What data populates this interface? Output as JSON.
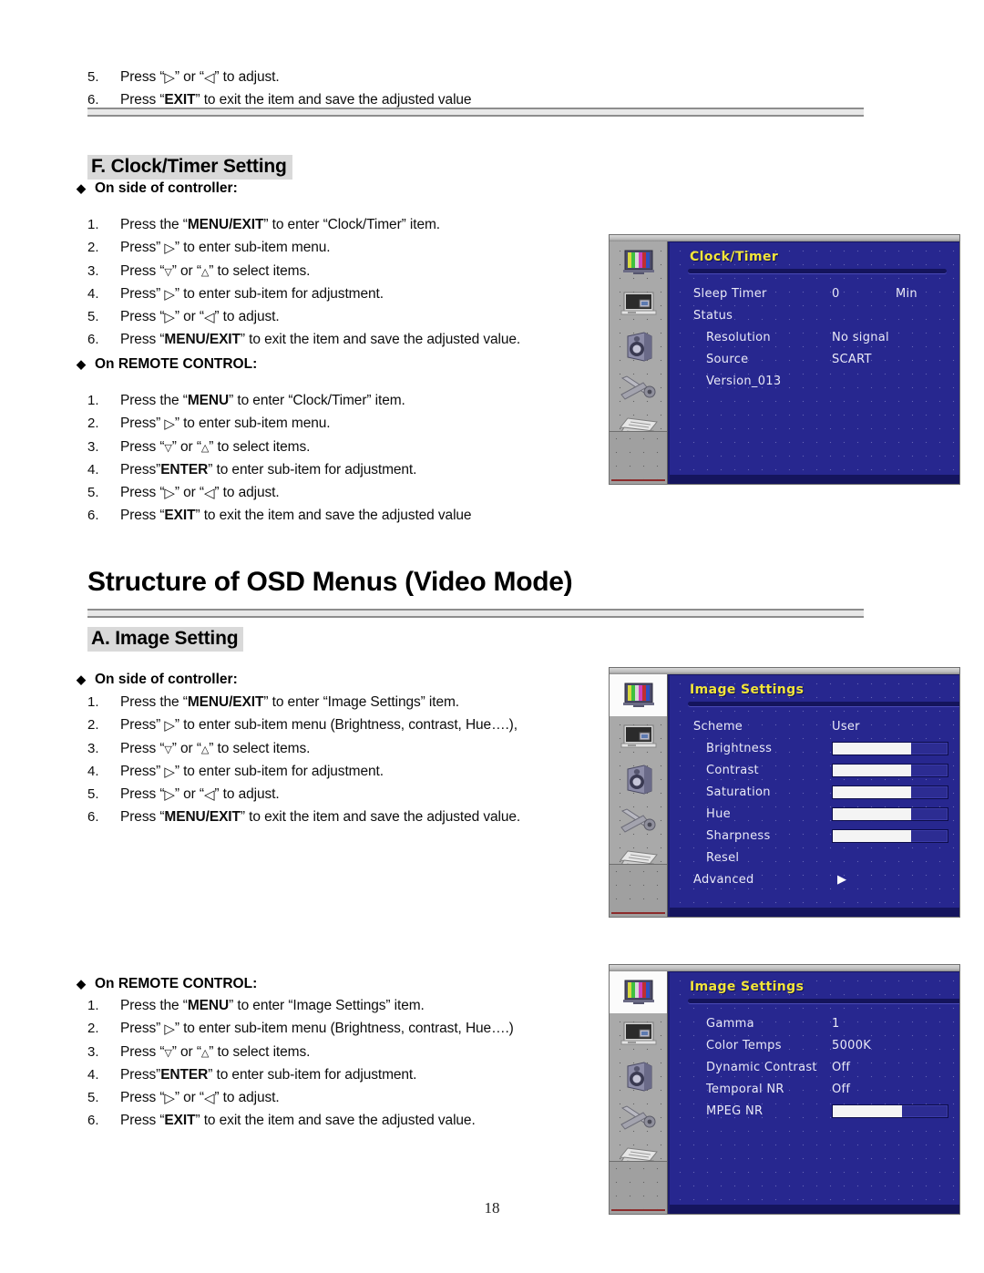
{
  "page": {
    "number": "18"
  },
  "top_steps": [
    {
      "num": "5.",
      "pre": "Press “",
      "sym": "▷",
      "mid": "” or “",
      "sym2": "◁",
      "post": "” to adjust."
    },
    {
      "num": "6.",
      "pre": "Press “",
      "bold": "EXIT",
      "post": "” to exit the item and save the adjusted value"
    }
  ],
  "clock_section": {
    "heading": "F. Clock/Timer Setting",
    "controller_label": "On side of controller:",
    "controller_steps": [
      {
        "num": "1.",
        "pre": "Press the “",
        "bold": "MENU/EXIT",
        "post": "” to enter “Clock/Timer” item."
      },
      {
        "num": "2.",
        "pre": "Press” ",
        "sym": "▷",
        "post": "” to enter sub-item menu."
      },
      {
        "num": "3.",
        "pre": "Press “",
        "symsm": "▽",
        "mid": "” or “",
        "symsm2": "△",
        "post": "” to select items."
      },
      {
        "num": "4.",
        "pre": "Press” ",
        "sym": "▷",
        "post": "” to enter sub-item for adjustment."
      },
      {
        "num": "5.",
        "pre": "Press “",
        "sym": "▷",
        "mid": "” or “",
        "sym2": "◁",
        "post": "” to adjust."
      },
      {
        "num": "6.",
        "pre": "Press “",
        "bold": "MENU/EXIT",
        "post": "” to exit the item and save the adjusted value."
      }
    ],
    "remote_label": "On REMOTE CONTROL:",
    "remote_steps": [
      {
        "num": "1.",
        "pre": "Press the “",
        "bold": "MENU",
        "post": "” to enter “Clock/Timer” item."
      },
      {
        "num": "2.",
        "pre": "Press” ",
        "sym": "▷",
        "post": "” to enter sub-item menu."
      },
      {
        "num": "3.",
        "pre": "Press “",
        "symsm": "▽",
        "mid": "” or “",
        "symsm2": "△",
        "post": "” to select items."
      },
      {
        "num": "4.",
        "pre": "Press”",
        "bold": "ENTER",
        "post": "” to enter sub-item for adjustment."
      },
      {
        "num": "5.",
        "pre": "Press “",
        "sym": "▷",
        "mid": "” or “",
        "sym2": "◁",
        "post": "” to adjust."
      },
      {
        "num": "6.",
        "pre": "Press “",
        "bold": "EXIT",
        "post": "” to exit the item and save the adjusted value"
      }
    ]
  },
  "structure_title": "Structure of OSD Menus (Video Mode)",
  "image_section": {
    "heading": "A. Image Setting",
    "controller_label": "On side of controller:",
    "controller_steps": [
      {
        "num": "1.",
        "pre": "Press the “",
        "bold": "MENU/EXIT",
        "post": "” to enter “Image Settings” item."
      },
      {
        "num": "2.",
        "pre": "Press” ",
        "sym": "▷",
        "post": "” to enter sub-item menu (Brightness, contrast, Hue….),"
      },
      {
        "num": "3.",
        "pre": "Press “",
        "symsm": "▽",
        "mid": "” or “",
        "symsm2": "△",
        "post": "” to select items."
      },
      {
        "num": "4.",
        "pre": "Press” ",
        "sym": "▷",
        "post": "” to enter sub-item for adjustment."
      },
      {
        "num": "5.",
        "pre": "Press “",
        "sym": "▷",
        "mid": "” or “",
        "sym2": "◁",
        "post": "” to adjust."
      },
      {
        "num": "6.",
        "pre": "Press “",
        "bold": "MENU/EXIT",
        "post": "” to exit the item and save the adjusted value."
      }
    ],
    "remote_label": "On REMOTE CONTROL:",
    "remote_steps": [
      {
        "num": "1.",
        "pre": "Press the “",
        "bold": "MENU",
        "post": "” to enter “Image Settings” item."
      },
      {
        "num": "2.",
        "pre": "Press” ",
        "sym": "▷",
        "post": "” to enter sub-item menu (Brightness, contrast, Hue….)"
      },
      {
        "num": "3.",
        "pre": "Press “",
        "symsm": "▽",
        "mid": "” or “",
        "symsm2": "△",
        "post": "” to select items."
      },
      {
        "num": "4.",
        "pre": "Press”",
        "bold": "ENTER",
        "post": "” to enter sub-item for adjustment."
      },
      {
        "num": "5.",
        "pre": "Press “",
        "sym": "▷",
        "mid": "” or “",
        "sym2": "◁",
        "post": "” to adjust."
      },
      {
        "num": "6.",
        "pre": "Press “",
        "bold": "EXIT",
        "post": "” to exit the item and save the adjusted value."
      }
    ]
  },
  "osd_colors": {
    "background": "#27278f",
    "title_text": "#f2e53a",
    "row_text": "#e9e9f6",
    "sidebar": "#a9a9a9",
    "header_bar": "#15155e"
  },
  "osd_sidebar_icons": [
    "picture-tv-icon",
    "pc-monitor-icon",
    "speaker-icon",
    "wrench-tool-icon",
    "documents-icon",
    "clock-icon"
  ],
  "osd_clock_timer": {
    "title": "Clock/Timer",
    "selected_icon_index": 5,
    "rows": [
      {
        "label": "Sleep Timer",
        "value": "0",
        "unit": "Min",
        "indent": 0
      },
      {
        "label": "Status",
        "value": "",
        "unit": "",
        "indent": 0
      },
      {
        "label": "Resolution",
        "value": "No signal",
        "unit": "",
        "indent": 1
      },
      {
        "label": "Source",
        "value": "SCART",
        "unit": "",
        "indent": 1
      },
      {
        "label": "Version_013",
        "value": "",
        "unit": "",
        "indent": 1
      }
    ]
  },
  "osd_image_settings": {
    "title": "Image Settings",
    "selected_icon_index": 0,
    "rows": [
      {
        "label": "Scheme",
        "value": "User",
        "type": "text",
        "indent": 0
      },
      {
        "label": "Brightness",
        "type": "slider",
        "fill": 68,
        "value": "0",
        "indent": 1
      },
      {
        "label": "Contrast",
        "type": "slider",
        "fill": 68,
        "value": "0",
        "indent": 1
      },
      {
        "label": "Saturation",
        "type": "slider",
        "fill": 68,
        "value": "0",
        "indent": 1
      },
      {
        "label": "Hue",
        "type": "slider",
        "fill": 68,
        "value": "0",
        "indent": 1
      },
      {
        "label": "Sharpness",
        "type": "slider",
        "fill": 68,
        "value": "0",
        "indent": 1
      },
      {
        "label": "Resel",
        "type": "text",
        "value": "",
        "indent": 1
      },
      {
        "label": "Advanced",
        "type": "arrow",
        "value": "▶",
        "indent": 0
      }
    ]
  },
  "osd_image_advanced": {
    "title": "Image Settings",
    "selected_icon_index": 0,
    "rows": [
      {
        "label": "Gamma",
        "value": "1",
        "type": "text",
        "indent": 1
      },
      {
        "label": "Color Temps",
        "value": "5000K",
        "type": "text",
        "indent": 1
      },
      {
        "label": "Dynamic Contrast",
        "value": "Off",
        "type": "text",
        "indent": 1
      },
      {
        "label": "Temporal NR",
        "value": "Off",
        "type": "text",
        "indent": 1
      },
      {
        "label": "MPEG NR",
        "type": "slider",
        "fill": 60,
        "value": "0",
        "indent": 1
      }
    ]
  }
}
